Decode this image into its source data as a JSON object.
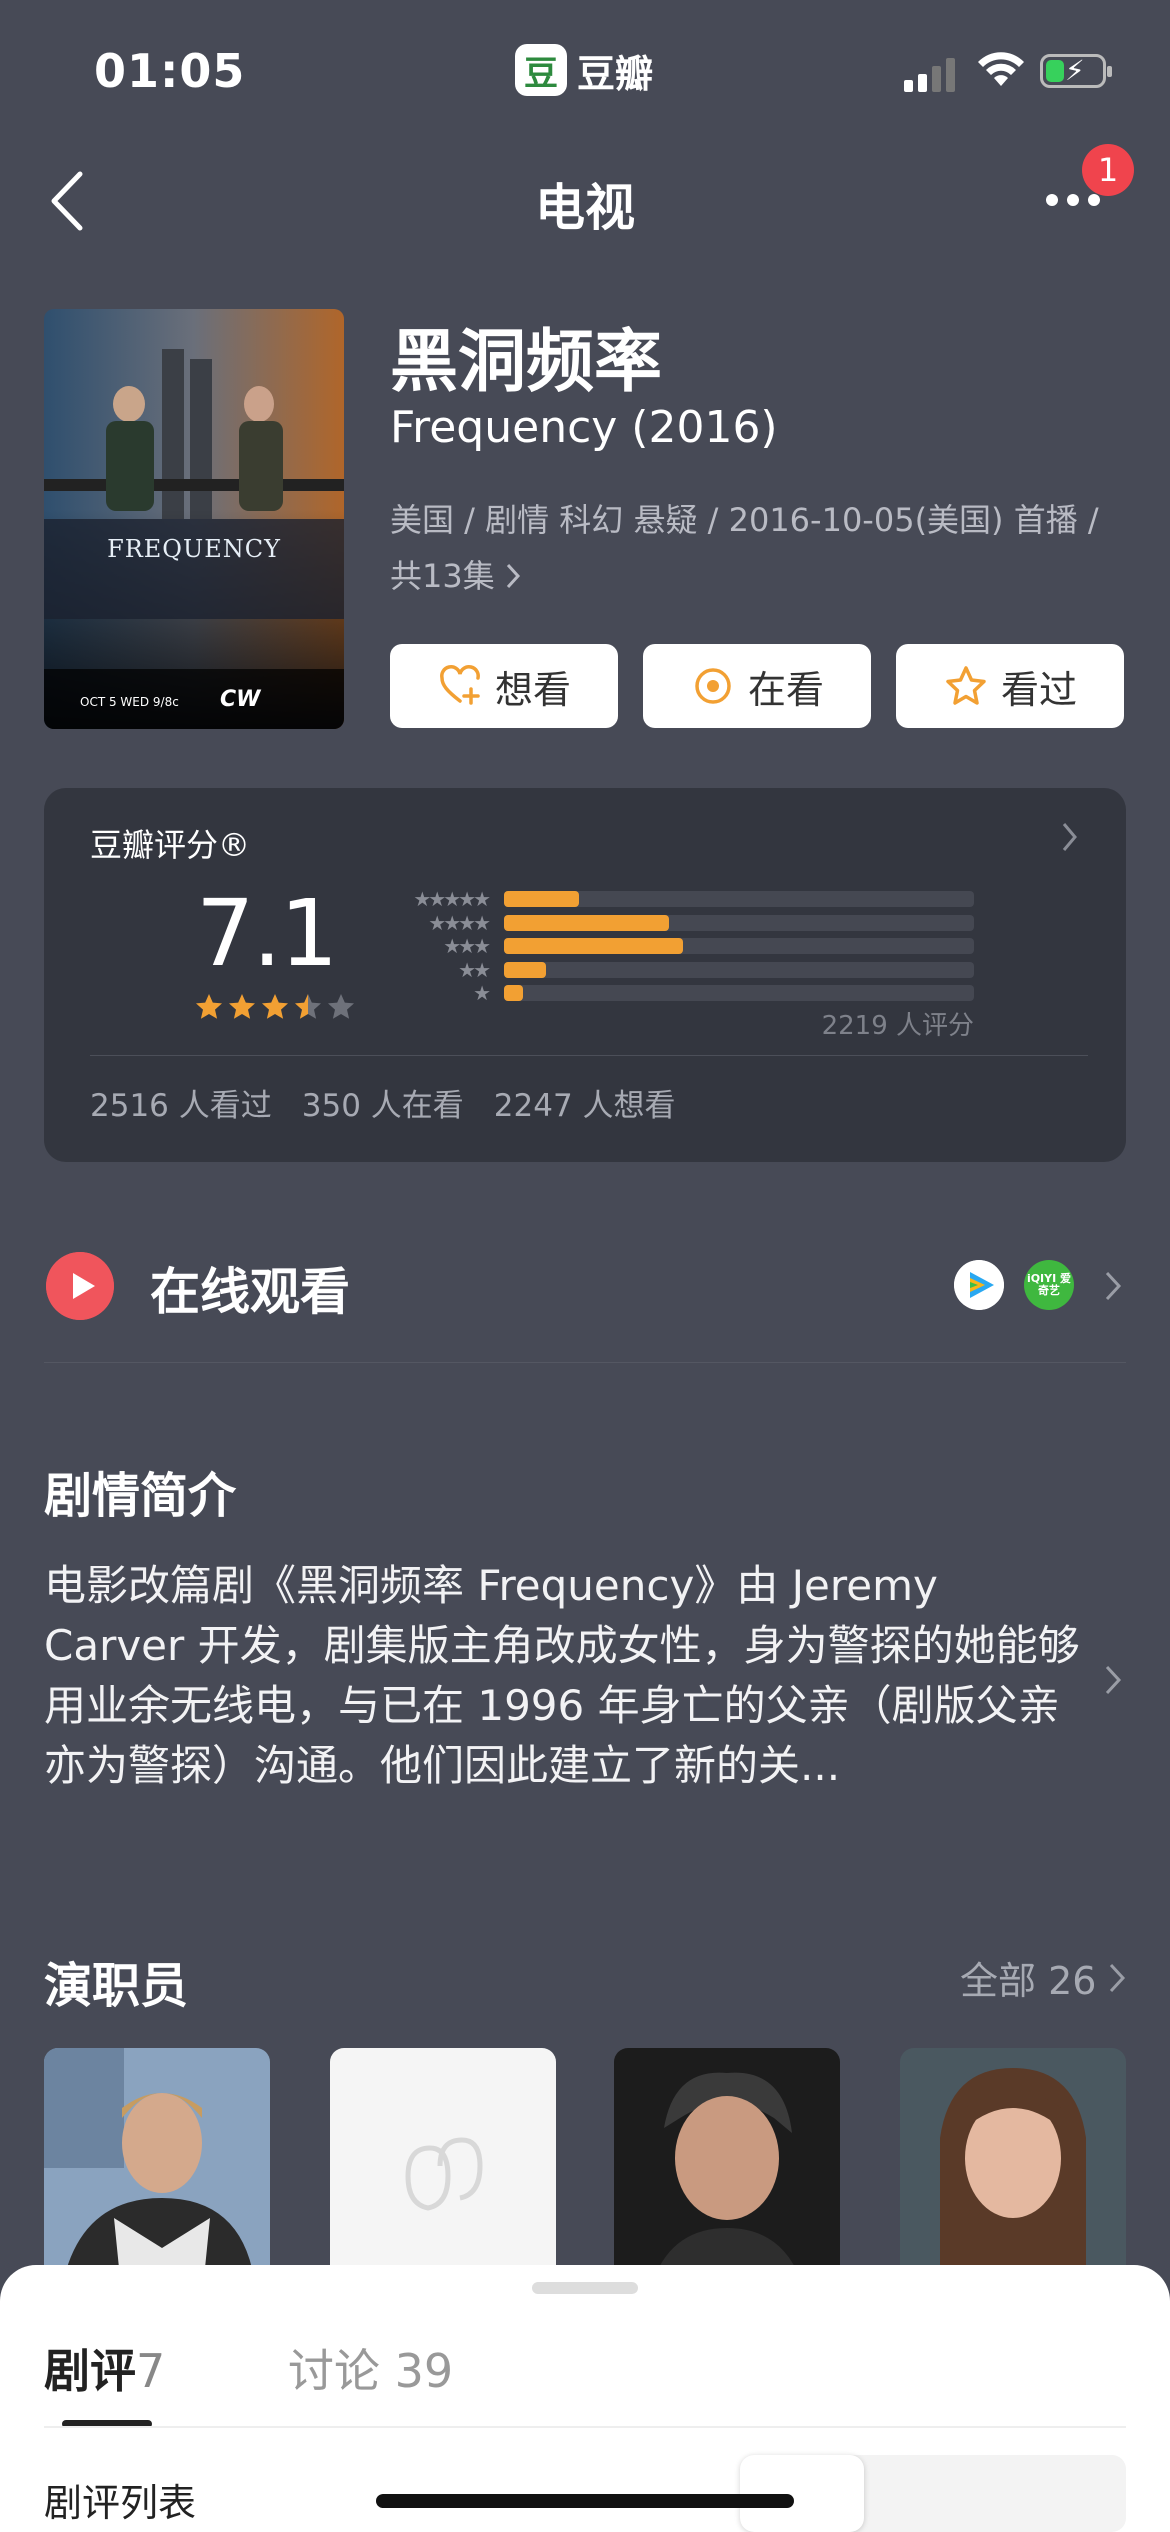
{
  "status_bar": {
    "time": "01:05",
    "app_logo": "豆",
    "app_name": "豆瓣"
  },
  "nav": {
    "title": "电视",
    "badge": "1"
  },
  "show": {
    "title_cn": "黑洞频率",
    "title_en": "Frequency (2016)",
    "meta": "美国 / 剧情 科幻 悬疑 / 2016-10-05(美国) 首播 /",
    "episodes": "共13集",
    "poster_text": "FREQUENCY",
    "poster_small": "OCT 5 WED 9/8c"
  },
  "actions": [
    {
      "label": "想看",
      "icon": "heart-plus-icon"
    },
    {
      "label": "在看",
      "icon": "target-icon"
    },
    {
      "label": "看过",
      "icon": "star-outline-icon"
    }
  ],
  "rating": {
    "label": "豆瓣评分®",
    "score": "7.1",
    "star_value": 3.5,
    "distribution": [
      {
        "stars": "★★★★★",
        "percent": 16
      },
      {
        "stars": "★★★★",
        "percent": 35
      },
      {
        "stars": "★★★",
        "percent": 38
      },
      {
        "stars": "★★",
        "percent": 9
      },
      {
        "stars": "★",
        "percent": 4
      }
    ],
    "count": "2219 人评分",
    "watched": "2516 人看过",
    "watching": "350 人在看",
    "want": "2247 人想看"
  },
  "online": {
    "label": "在线观看",
    "vendor2": "iQIYI 爱奇艺"
  },
  "synopsis": {
    "title": "剧情简介",
    "text": "电影改篇剧《黑洞频率 Frequency》由 Jeremy Carver 开发，剧集版主角改成女性，身为警探的她能够用业余无线电，与已在 1996 年身亡的父亲（剧版父亲亦为警探）沟通。他们因此建立了新的关..."
  },
  "cast": {
    "title": "演职员",
    "all_label": "全部 26"
  },
  "sheet": {
    "tabs": [
      {
        "label": "剧评",
        "count": "7"
      },
      {
        "label": "讨论",
        "count": "39"
      }
    ],
    "list_label": "剧评列表"
  },
  "colors": {
    "background": "#474a56",
    "card": "#33363f",
    "accent": "#f2a033",
    "play_red": "#f0555c"
  }
}
